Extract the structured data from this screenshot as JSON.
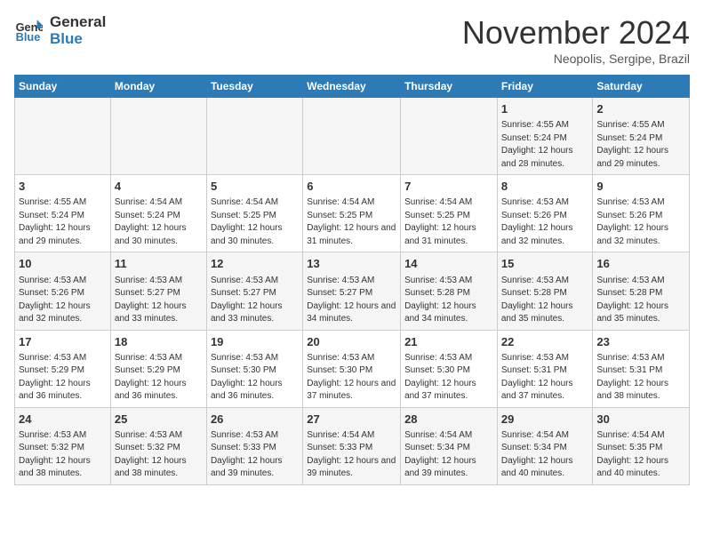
{
  "header": {
    "logo_line1": "General",
    "logo_line2": "Blue",
    "month": "November 2024",
    "location": "Neopolis, Sergipe, Brazil"
  },
  "days_of_week": [
    "Sunday",
    "Monday",
    "Tuesday",
    "Wednesday",
    "Thursday",
    "Friday",
    "Saturday"
  ],
  "weeks": [
    [
      {
        "num": "",
        "info": ""
      },
      {
        "num": "",
        "info": ""
      },
      {
        "num": "",
        "info": ""
      },
      {
        "num": "",
        "info": ""
      },
      {
        "num": "",
        "info": ""
      },
      {
        "num": "1",
        "info": "Sunrise: 4:55 AM\nSunset: 5:24 PM\nDaylight: 12 hours and 28 minutes."
      },
      {
        "num": "2",
        "info": "Sunrise: 4:55 AM\nSunset: 5:24 PM\nDaylight: 12 hours and 29 minutes."
      }
    ],
    [
      {
        "num": "3",
        "info": "Sunrise: 4:55 AM\nSunset: 5:24 PM\nDaylight: 12 hours and 29 minutes."
      },
      {
        "num": "4",
        "info": "Sunrise: 4:54 AM\nSunset: 5:24 PM\nDaylight: 12 hours and 30 minutes."
      },
      {
        "num": "5",
        "info": "Sunrise: 4:54 AM\nSunset: 5:25 PM\nDaylight: 12 hours and 30 minutes."
      },
      {
        "num": "6",
        "info": "Sunrise: 4:54 AM\nSunset: 5:25 PM\nDaylight: 12 hours and 31 minutes."
      },
      {
        "num": "7",
        "info": "Sunrise: 4:54 AM\nSunset: 5:25 PM\nDaylight: 12 hours and 31 minutes."
      },
      {
        "num": "8",
        "info": "Sunrise: 4:53 AM\nSunset: 5:26 PM\nDaylight: 12 hours and 32 minutes."
      },
      {
        "num": "9",
        "info": "Sunrise: 4:53 AM\nSunset: 5:26 PM\nDaylight: 12 hours and 32 minutes."
      }
    ],
    [
      {
        "num": "10",
        "info": "Sunrise: 4:53 AM\nSunset: 5:26 PM\nDaylight: 12 hours and 32 minutes."
      },
      {
        "num": "11",
        "info": "Sunrise: 4:53 AM\nSunset: 5:27 PM\nDaylight: 12 hours and 33 minutes."
      },
      {
        "num": "12",
        "info": "Sunrise: 4:53 AM\nSunset: 5:27 PM\nDaylight: 12 hours and 33 minutes."
      },
      {
        "num": "13",
        "info": "Sunrise: 4:53 AM\nSunset: 5:27 PM\nDaylight: 12 hours and 34 minutes."
      },
      {
        "num": "14",
        "info": "Sunrise: 4:53 AM\nSunset: 5:28 PM\nDaylight: 12 hours and 34 minutes."
      },
      {
        "num": "15",
        "info": "Sunrise: 4:53 AM\nSunset: 5:28 PM\nDaylight: 12 hours and 35 minutes."
      },
      {
        "num": "16",
        "info": "Sunrise: 4:53 AM\nSunset: 5:28 PM\nDaylight: 12 hours and 35 minutes."
      }
    ],
    [
      {
        "num": "17",
        "info": "Sunrise: 4:53 AM\nSunset: 5:29 PM\nDaylight: 12 hours and 36 minutes."
      },
      {
        "num": "18",
        "info": "Sunrise: 4:53 AM\nSunset: 5:29 PM\nDaylight: 12 hours and 36 minutes."
      },
      {
        "num": "19",
        "info": "Sunrise: 4:53 AM\nSunset: 5:30 PM\nDaylight: 12 hours and 36 minutes."
      },
      {
        "num": "20",
        "info": "Sunrise: 4:53 AM\nSunset: 5:30 PM\nDaylight: 12 hours and 37 minutes."
      },
      {
        "num": "21",
        "info": "Sunrise: 4:53 AM\nSunset: 5:30 PM\nDaylight: 12 hours and 37 minutes."
      },
      {
        "num": "22",
        "info": "Sunrise: 4:53 AM\nSunset: 5:31 PM\nDaylight: 12 hours and 37 minutes."
      },
      {
        "num": "23",
        "info": "Sunrise: 4:53 AM\nSunset: 5:31 PM\nDaylight: 12 hours and 38 minutes."
      }
    ],
    [
      {
        "num": "24",
        "info": "Sunrise: 4:53 AM\nSunset: 5:32 PM\nDaylight: 12 hours and 38 minutes."
      },
      {
        "num": "25",
        "info": "Sunrise: 4:53 AM\nSunset: 5:32 PM\nDaylight: 12 hours and 38 minutes."
      },
      {
        "num": "26",
        "info": "Sunrise: 4:53 AM\nSunset: 5:33 PM\nDaylight: 12 hours and 39 minutes."
      },
      {
        "num": "27",
        "info": "Sunrise: 4:54 AM\nSunset: 5:33 PM\nDaylight: 12 hours and 39 minutes."
      },
      {
        "num": "28",
        "info": "Sunrise: 4:54 AM\nSunset: 5:34 PM\nDaylight: 12 hours and 39 minutes."
      },
      {
        "num": "29",
        "info": "Sunrise: 4:54 AM\nSunset: 5:34 PM\nDaylight: 12 hours and 40 minutes."
      },
      {
        "num": "30",
        "info": "Sunrise: 4:54 AM\nSunset: 5:35 PM\nDaylight: 12 hours and 40 minutes."
      }
    ]
  ]
}
